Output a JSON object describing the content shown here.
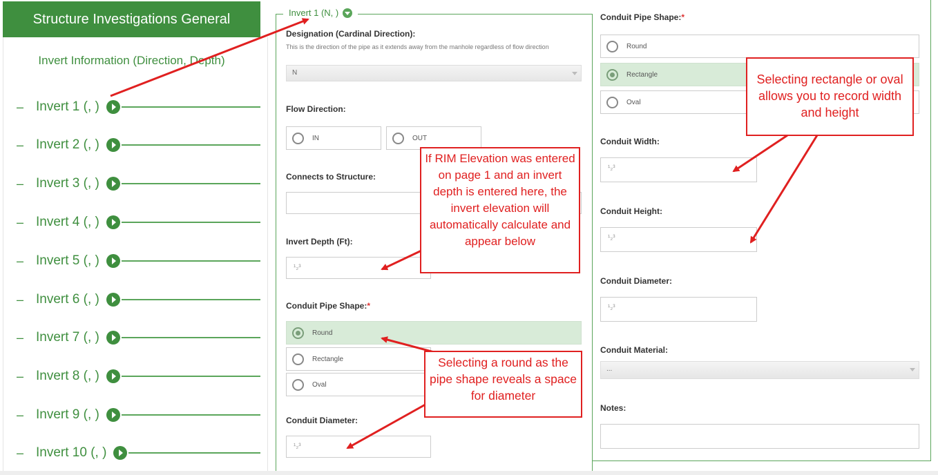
{
  "sidebar": {
    "header": "Structure Investigations General",
    "section_title": "Invert Information (Direction, Depth)",
    "inverts": [
      {
        "dash": "–",
        "label": "Invert 1 (, )"
      },
      {
        "dash": "–",
        "label": "Invert 2 (, )"
      },
      {
        "dash": "–",
        "label": "Invert 3 (, )"
      },
      {
        "dash": "–",
        "label": "Invert 4 (, )"
      },
      {
        "dash": "–",
        "label": "Invert 5 (, )"
      },
      {
        "dash": "–",
        "label": "Invert 6 (, )"
      },
      {
        "dash": "–",
        "label": "Invert 7 (, )"
      },
      {
        "dash": "–",
        "label": "Invert 8 (, )"
      },
      {
        "dash": "–",
        "label": "Invert 9 (, )"
      },
      {
        "dash": "–",
        "label": "Invert 10 (, )"
      }
    ]
  },
  "form": {
    "group_title": "Invert 1 (N, )",
    "designation": {
      "label": "Designation (Cardinal Direction):",
      "hint": "This is the direction of the pipe as it extends away from the manhole regardless of flow direction",
      "value": "N"
    },
    "flow_direction": {
      "label": "Flow Direction:",
      "options": [
        "IN",
        "OUT"
      ]
    },
    "connects_to": {
      "label": "Connects to Structure:"
    },
    "invert_depth": {
      "label": "Invert Depth (Ft):",
      "placeholder": "¹₂³"
    },
    "pipe_shape": {
      "label": "Conduit Pipe Shape:",
      "required_mark": "*",
      "options": [
        "Round",
        "Rectangle",
        "Oval"
      ],
      "selected": "Round"
    },
    "diameter": {
      "label": "Conduit Diameter:",
      "placeholder": "¹₂³"
    }
  },
  "right_form": {
    "pipe_shape": {
      "label": "Conduit Pipe Shape:",
      "required_mark": "*",
      "options": [
        "Round",
        "Rectangle",
        "Oval"
      ],
      "selected": "Rectangle"
    },
    "width": {
      "label": "Conduit Width:",
      "placeholder": "¹₂³"
    },
    "height": {
      "label": "Conduit Height:",
      "placeholder": "¹₂³"
    },
    "diameter": {
      "label": "Conduit Diameter:",
      "placeholder": "¹₂³"
    },
    "material": {
      "label": "Conduit Material:",
      "value": "..."
    },
    "notes": {
      "label": "Notes:"
    }
  },
  "annotations": {
    "rim_note": "If RIM Elevation was entered on page 1 and an invert depth is entered here, the invert elevation will automatically calculate and appear below",
    "round_note": "Selecting a round as the pipe shape reveals a space for diameter",
    "rect_note": "Selecting rectangle or oval allows you to record width and height"
  },
  "colors": {
    "accent_green": "#3f8f3f",
    "selected_bg": "#d8ebd8",
    "annotation_red": "#e02020"
  }
}
